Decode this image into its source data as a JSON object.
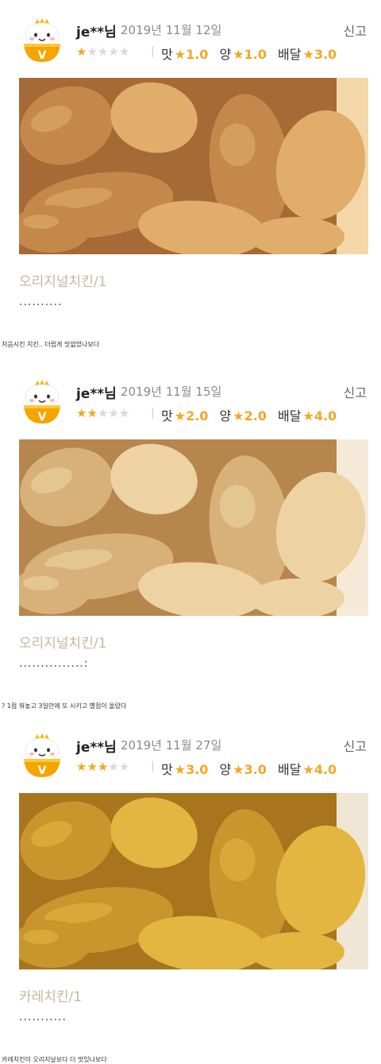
{
  "reviews": [
    {
      "nickname": "je**님",
      "date": "2019년 11월 12일",
      "report": "신고",
      "rating": 1,
      "taste_label": "맛",
      "taste": "1.0",
      "amount_label": "양",
      "amount": "1.0",
      "delivery_label": "배달",
      "delivery": "3.0",
      "menu": "오리지널치킨/1",
      "text": "..........",
      "caption": "처음시킨 치킨.. 더럽게 맛없었나보다",
      "photo_colors": [
        "#c4884a",
        "#e0ad6a",
        "#a56a35",
        "#f3d7a8"
      ]
    },
    {
      "nickname": "je**님",
      "date": "2019년 11월 15일",
      "report": "신고",
      "rating": 2,
      "taste_label": "맛",
      "taste": "2.0",
      "amount_label": "양",
      "amount": "2.0",
      "delivery_label": "배달",
      "delivery": "4.0",
      "menu": "오리지널치킨/1",
      "text": "...............:",
      "caption": "? 1점 줘놓고 3일만에 또 시키고 별점이 올랐다",
      "photo_colors": [
        "#d8b17a",
        "#edd3a3",
        "#b7864d",
        "#f5ead7"
      ]
    },
    {
      "nickname": "je**님",
      "date": "2019년 11월 27일",
      "report": "신고",
      "rating": 3,
      "taste_label": "맛",
      "taste": "3.0",
      "amount_label": "양",
      "amount": "3.0",
      "delivery_label": "배달",
      "delivery": "4.0",
      "menu": "카레치킨/1",
      "text": "...........",
      "caption": "카레치킨이 오리지날보다 더 맛있나보다",
      "photo_colors": [
        "#c9962e",
        "#e2b640",
        "#a8741e",
        "#f0e6d6"
      ]
    }
  ],
  "star_glyph": "★",
  "accent_color": "#f5a623"
}
